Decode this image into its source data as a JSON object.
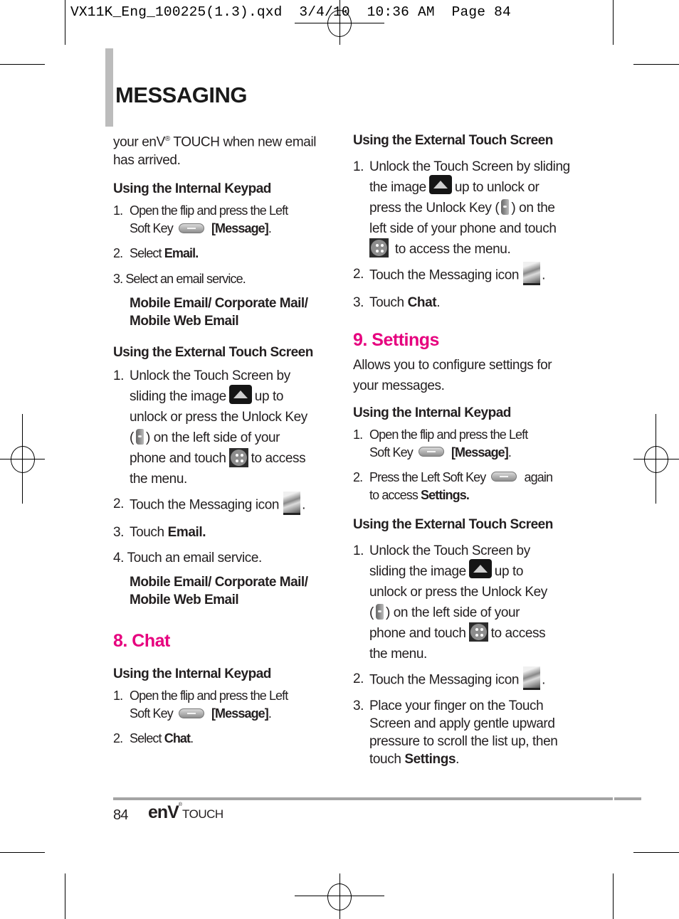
{
  "slug": "VX11K_Eng_100225(1.3).qxd  3/4/10  10:36 AM  Page 84",
  "title": "MESSAGING",
  "colors": {
    "section_heading": "#e6007e",
    "title_bar": "#bcbcbc",
    "footer_rule": "#a4a4a4"
  },
  "left": {
    "intro": [
      "your enV",
      "®",
      " TOUCH when new email",
      "has arrived."
    ],
    "email_keypad": {
      "heading": "Using the Internal Keypad",
      "steps": [
        {
          "n": "1.",
          "a": "Open the flip and press the Left",
          "b": "Soft Key",
          "icon": "soft-key-icon",
          "c": "[Message]",
          "d": "."
        },
        {
          "n": "2.",
          "a": "Select ",
          "b": "Email."
        },
        {
          "n": "3.",
          "a": "Select an email service."
        }
      ],
      "services": [
        "Mobile Email/ Corporate Mail/",
        "Mobile Web Email"
      ]
    },
    "email_touch": {
      "heading": "Using the External Touch Screen",
      "step1": [
        "Unlock the Touch Screen by",
        "sliding the image",
        "up to",
        "unlock or press the Unlock Key",
        "(",
        ") on the left side of your",
        "phone and touch",
        "to access",
        "the menu."
      ],
      "step2": [
        "Touch the Messaging icon",
        "."
      ],
      "step3": [
        "Touch ",
        "Email."
      ],
      "step4": "Touch an email service.",
      "services": [
        "Mobile Email/ Corporate Mail/",
        "Mobile Web Email"
      ]
    },
    "chat": {
      "heading": "8. Chat",
      "sub": "Using the Internal Keypad",
      "step1": [
        "Open the flip and press the Left",
        "Soft Key",
        "[Message]",
        "."
      ],
      "step2": [
        "Select ",
        "Chat",
        "."
      ]
    }
  },
  "right": {
    "chat_touch": {
      "heading": "Using the External Touch Screen",
      "step1": [
        "Unlock the Touch Screen by sliding",
        "the image",
        "up to unlock or",
        "press the Unlock Key (",
        ") on the",
        "left side of your phone and touch",
        "to access the menu."
      ],
      "step2": [
        "Touch the Messaging icon",
        "."
      ],
      "step3": [
        "Touch ",
        "Chat",
        "."
      ]
    },
    "settings": {
      "heading": "9. Settings",
      "desc": [
        "Allows you to configure settings for",
        "your messages."
      ],
      "keypad_heading": "Using the Internal Keypad",
      "k1": [
        "Open the flip and press the Left",
        "Soft Key",
        "[Message]",
        "."
      ],
      "k2": [
        "Press the Left Soft Key",
        "again",
        "to access ",
        "Settings."
      ],
      "touch_heading": "Using the External Touch Screen",
      "t1": [
        "Unlock the Touch Screen by",
        "sliding the image",
        "up to",
        "unlock or press the Unlock Key",
        "(",
        ") on the left side of your",
        "phone and touch",
        "to access",
        "the menu."
      ],
      "t2": [
        "Touch the Messaging icon",
        "."
      ],
      "t3": [
        "Place your finger on the Touch",
        "Screen and apply gentle upward",
        "pressure to scroll the list up, then",
        "touch ",
        "Settings",
        "."
      ]
    }
  },
  "footer": {
    "page": "84",
    "brand_main": "enV",
    "brand_reg": "®",
    "brand_sub": "TOUCH"
  },
  "numbers": {
    "n1": "1.",
    "n2": "2.",
    "n3": "3.",
    "n4": "4."
  }
}
